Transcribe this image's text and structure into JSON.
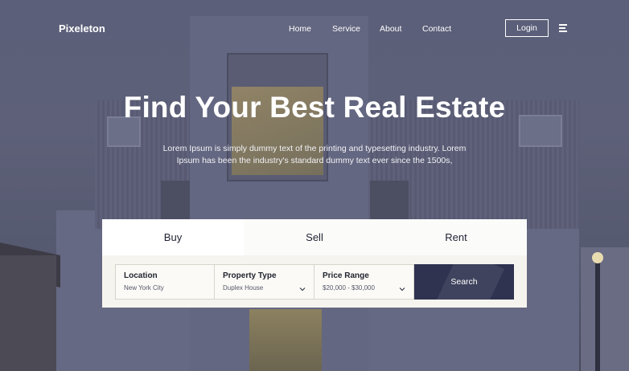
{
  "nav": {
    "logo": "Pixeleton",
    "links": [
      "Home",
      "Service",
      "About",
      "Contact"
    ],
    "login": "Login",
    "menu_icon": "hamburger-icon"
  },
  "hero": {
    "title": "Find Your Best Real Estate",
    "subtitle_line1": "Lorem Ipsum is simply dummy text of the printing and typesetting industry. Lorem",
    "subtitle_line2": "Ipsum has been the industry's standard dummy text ever since the 1500s,"
  },
  "search": {
    "tabs": [
      "Buy",
      "Sell",
      "Rent"
    ],
    "active_tab": "Buy",
    "fields": [
      {
        "label": "Location",
        "value": "New York City",
        "has_dropdown": false
      },
      {
        "label": "Property Type",
        "value": "Duplex House",
        "has_dropdown": true
      },
      {
        "label": "Price Range",
        "value": "$20,000 - $30,000",
        "has_dropdown": true
      }
    ],
    "button": "Search"
  },
  "colors": {
    "accent": "#2f3350",
    "panel": "#f6f4ee",
    "text_dark": "#1f2333"
  }
}
